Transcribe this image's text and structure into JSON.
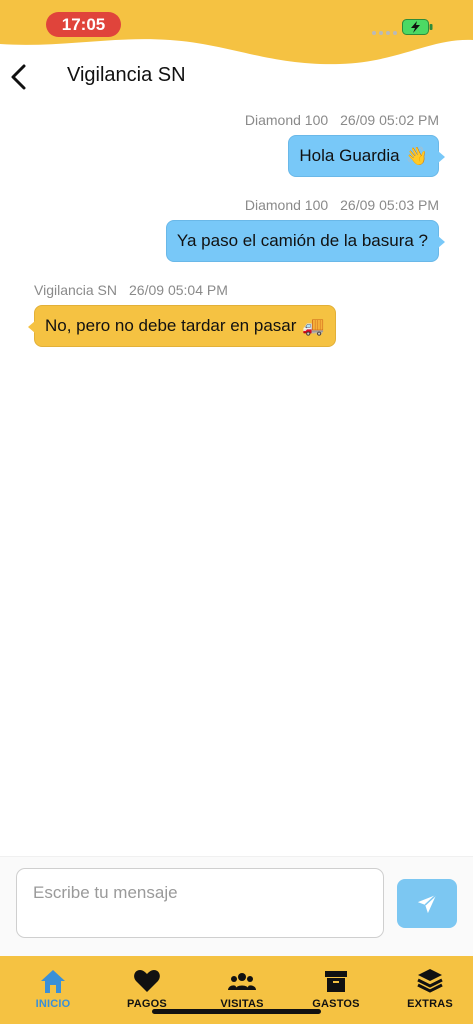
{
  "status_bar": {
    "time": "17:05"
  },
  "header": {
    "title": "Vigilancia SN"
  },
  "messages": [
    {
      "sender": "Diamond 100",
      "timestamp": "26/09 05:02 PM",
      "text": "Hola Guardia",
      "emoji": "👋",
      "direction": "outgoing"
    },
    {
      "sender": "Diamond 100",
      "timestamp": "26/09 05:03 PM",
      "text": "Ya paso el camión de la basura ?",
      "emoji": "",
      "direction": "outgoing"
    },
    {
      "sender": "Vigilancia SN",
      "timestamp": "26/09 05:04 PM",
      "text": "No, pero no debe tardar en pasar",
      "emoji": "🚚",
      "direction": "incoming"
    }
  ],
  "composer": {
    "placeholder": "Escribe tu mensaje",
    "value": ""
  },
  "tabs": [
    {
      "label": "INICIO",
      "icon": "home-icon",
      "active": true
    },
    {
      "label": "PAGOS",
      "icon": "heart-icon",
      "active": false
    },
    {
      "label": "VISITAS",
      "icon": "users-icon",
      "active": false
    },
    {
      "label": "GASTOS",
      "icon": "archive-box-icon",
      "active": false
    },
    {
      "label": "EXTRAS",
      "icon": "layers-icon",
      "active": false
    }
  ],
  "colors": {
    "accent_yellow": "#f5c242",
    "outgoing_bubble": "#78c8f8",
    "incoming_bubble": "#f5c242",
    "active_tab": "#3a90d8",
    "time_pill": "#e0443b",
    "battery_green": "#4cd964"
  }
}
